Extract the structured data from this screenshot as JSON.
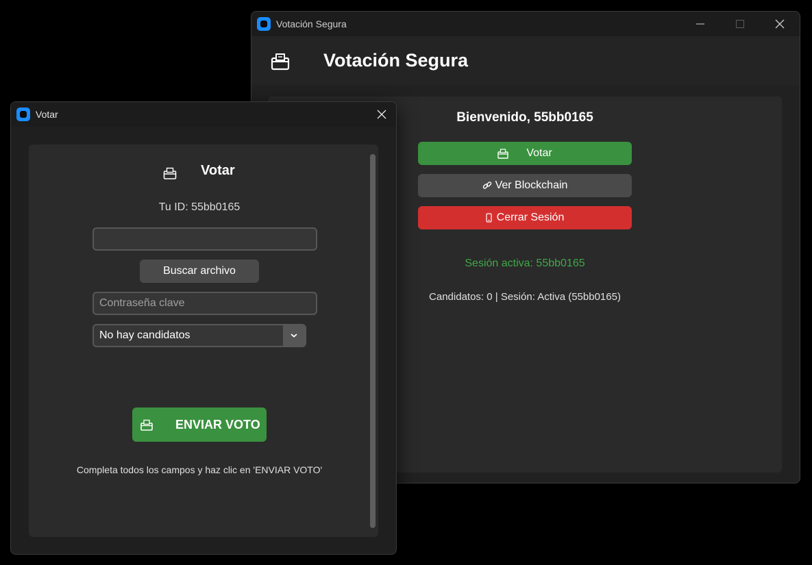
{
  "main_window": {
    "title": "Votación Segura",
    "header_title": "Votación Segura",
    "welcome": "Bienvenido, 55bb0165",
    "buttons": {
      "vote": "Votar",
      "blockchain": "Ver Blockchain",
      "logout": "Cerrar Sesión"
    },
    "session_text": "Sesión activa: 55bb0165",
    "status_text": "Candidatos: 0 | Sesión: Activa (55bb0165)"
  },
  "vote_window": {
    "title": "Votar",
    "header_title": "Votar",
    "id_text": "Tu ID: 55bb0165",
    "file_path_value": "",
    "browse_label": "Buscar archivo",
    "password_placeholder": "Contraseña clave",
    "candidate_selected": "No hay candidatos",
    "send_label": "ENVIAR VOTO",
    "hint": "Completa todos los campos y haz clic en 'ENVIAR VOTO'"
  },
  "icons": {
    "app": "app-logo-icon",
    "ballot": "ballot-box-icon",
    "link": "link-icon",
    "phone": "phone-icon",
    "chevron": "chevron-down-icon"
  },
  "colors": {
    "accent_blue": "#1a8cff",
    "green": "#3a913f",
    "red": "#d42f2f",
    "session_green": "#40a848",
    "gray_button": "#4a4a4a"
  }
}
